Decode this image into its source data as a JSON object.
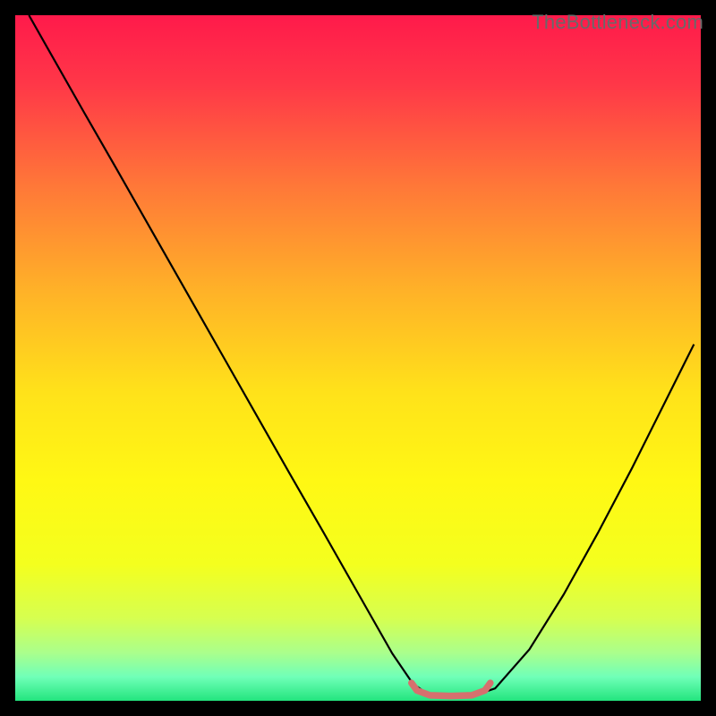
{
  "watermark": "TheBottleneck.com",
  "chart_data": {
    "type": "line",
    "title": "",
    "xlabel": "",
    "ylabel": "",
    "xlim": [
      0,
      100
    ],
    "ylim": [
      0,
      100
    ],
    "background_gradient": {
      "stops": [
        {
          "offset": 0.0,
          "color": "#ff1a4b"
        },
        {
          "offset": 0.1,
          "color": "#ff3748"
        },
        {
          "offset": 0.25,
          "color": "#ff7838"
        },
        {
          "offset": 0.4,
          "color": "#ffb128"
        },
        {
          "offset": 0.55,
          "color": "#ffe21a"
        },
        {
          "offset": 0.68,
          "color": "#fff814"
        },
        {
          "offset": 0.8,
          "color": "#f4ff1e"
        },
        {
          "offset": 0.88,
          "color": "#d6ff50"
        },
        {
          "offset": 0.93,
          "color": "#aaff8c"
        },
        {
          "offset": 0.965,
          "color": "#70ffb8"
        },
        {
          "offset": 1.0,
          "color": "#23e57e"
        }
      ]
    },
    "series": [
      {
        "name": "bottleneck-curve",
        "stroke": "#000000",
        "stroke_width": 2.2,
        "x": [
          2,
          5,
          10,
          15,
          20,
          25,
          30,
          35,
          40,
          45,
          50,
          55,
          58,
          60,
          62,
          64,
          67,
          70,
          75,
          80,
          85,
          90,
          95,
          99
        ],
        "y": [
          100,
          94.7,
          85.9,
          77.2,
          68.4,
          59.6,
          50.8,
          42.0,
          33.2,
          24.5,
          15.7,
          6.9,
          2.5,
          1.1,
          0.7,
          0.7,
          0.8,
          1.8,
          7.5,
          15.5,
          24.5,
          34,
          44,
          52
        ]
      },
      {
        "name": "bottom-highlight",
        "stroke": "#d6706e",
        "stroke_width": 7.5,
        "linecap": "round",
        "x": [
          57.8,
          58.6,
          60.5,
          63.5,
          66.6,
          68.5,
          69.3
        ],
        "y": [
          2.6,
          1.5,
          0.8,
          0.7,
          0.8,
          1.5,
          2.6
        ]
      }
    ]
  }
}
